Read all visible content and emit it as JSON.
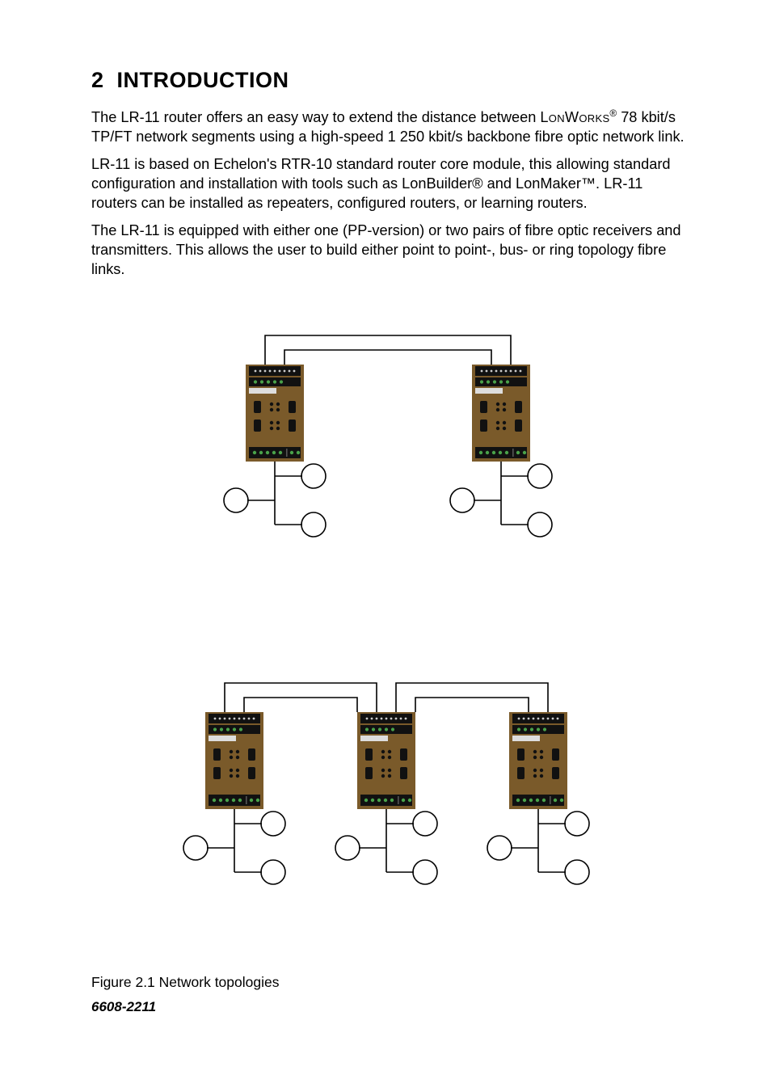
{
  "section": {
    "number": "2",
    "title": "INTRODUCTION"
  },
  "paras": {
    "p1a": "The LR-11 router offers an easy way to extend the distance between ",
    "p1_brand": "LonWorks",
    "p1b": " 78 kbit/s TP/FT network segments using a high-speed 1 250 kbit/s backbone fibre optic network link.",
    "p2": "LR-11 is based on Echelon's RTR-10 standard router core module, this allowing standard configuration and installation with tools such as LonBuilder® and LonMaker™. LR-11 routers can be installed as repeaters, configured routers, or learning routers.",
    "p3": "The LR-11 is equipped with either one (PP-version) or two pairs of fibre optic receivers and transmitters. This allows the user to build either point to point-, bus- or ring topology fibre links."
  },
  "figure": {
    "caption": "Figure 2.1 Network topologies"
  },
  "docnum": "6608-2211"
}
